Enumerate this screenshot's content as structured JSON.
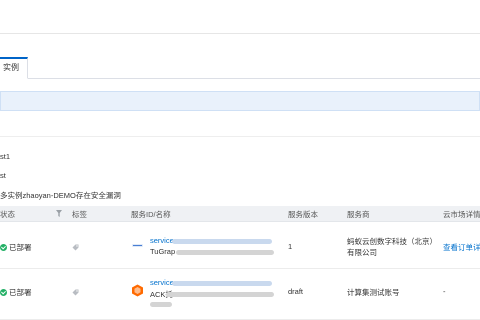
{
  "tabs": [
    {
      "label": "实例"
    }
  ],
  "alerts": [
    {
      "text": "st1"
    },
    {
      "text": "st"
    },
    {
      "text": "多实例zhaoyan-DEMO存在安全漏洞"
    }
  ],
  "table": {
    "columns": [
      "状态",
      "标签",
      "服务ID/名称",
      "服务版本",
      "服务商",
      "云市场详情"
    ],
    "rows": [
      {
        "status": "已部署",
        "service_id": "service",
        "service_name": "TuGrap",
        "version": "1",
        "provider_line1": "蚂蚁云创数字科技（北京）",
        "provider_line2": "有限公司",
        "market": "查看订单详"
      },
      {
        "status": "已部署",
        "service_id": "service",
        "service_name": "ACK托",
        "version": "draft",
        "provider_line1": "计算集测试账号",
        "provider_line2": "",
        "market": "-"
      }
    ]
  },
  "colors": {
    "accent": "#0064c8",
    "success": "#23b066",
    "link": "#0070cc"
  },
  "icons": [
    "filter-icon",
    "tag-icon",
    "check-circle-icon",
    "service-logo-icon"
  ]
}
